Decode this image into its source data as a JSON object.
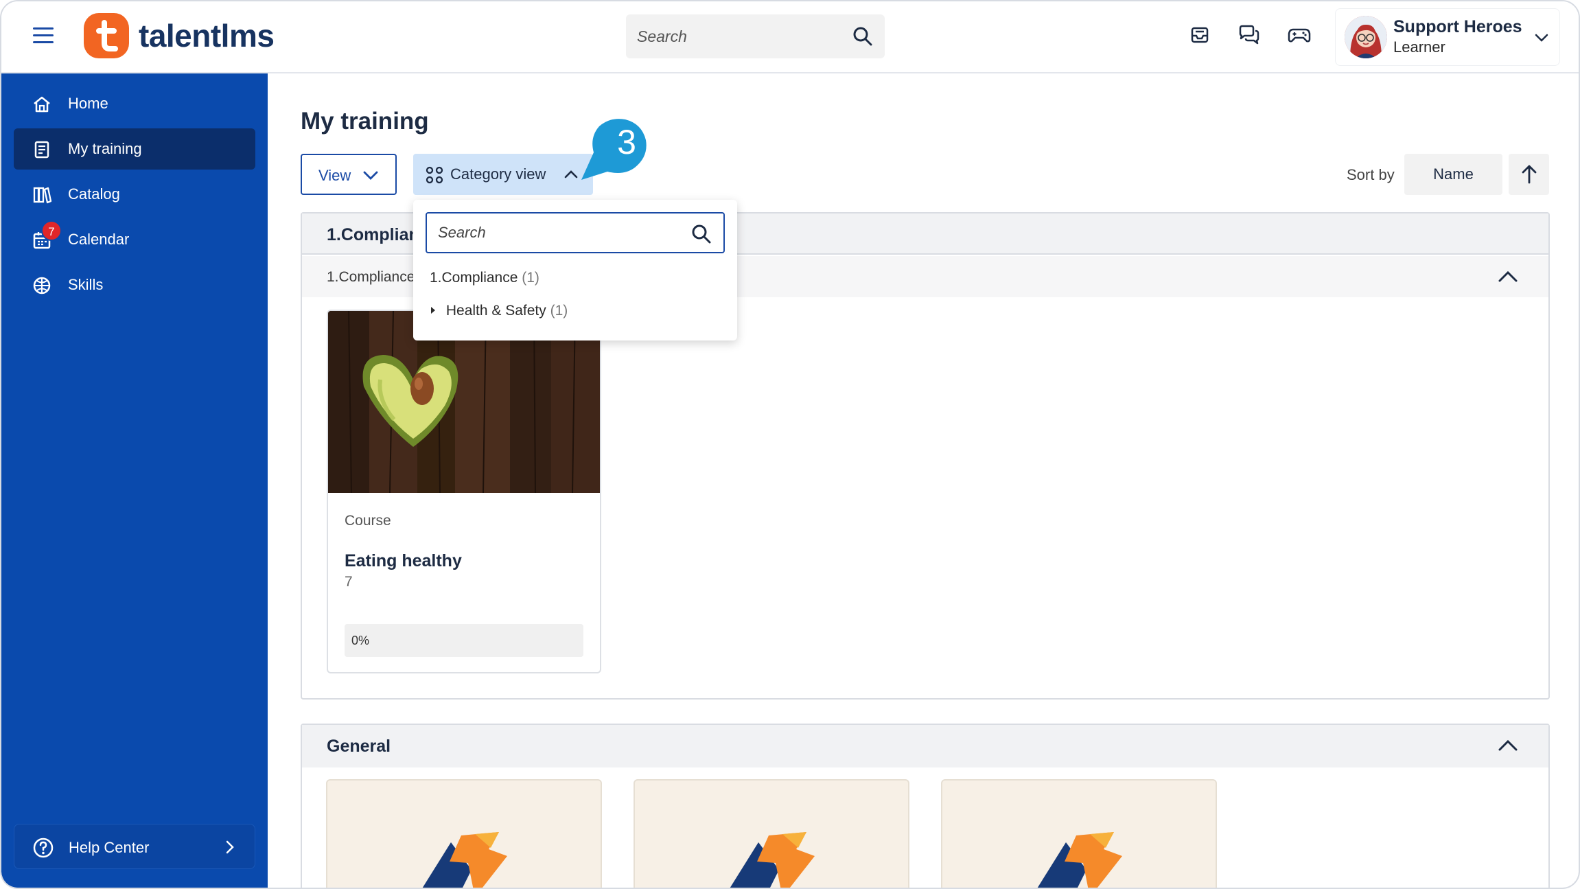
{
  "brand": {
    "name": "talentlms",
    "accent": "#f26522",
    "sidebar_color": "#0a4aad"
  },
  "header": {
    "search_placeholder": "Search",
    "user": {
      "name": "Support Heroes",
      "role": "Learner"
    }
  },
  "sidebar": {
    "items": [
      {
        "label": "Home",
        "icon": "home-icon"
      },
      {
        "label": "My training",
        "icon": "training-icon"
      },
      {
        "label": "Catalog",
        "icon": "catalog-icon"
      },
      {
        "label": "Calendar",
        "icon": "calendar-icon",
        "badge": "7"
      },
      {
        "label": "Skills",
        "icon": "skills-icon"
      }
    ],
    "help": "Help Center"
  },
  "main": {
    "title": "My training",
    "view_button": "View",
    "category_view_button": "Category view",
    "callout_number": "3",
    "sort_by_label": "Sort by",
    "sort_field": "Name"
  },
  "dropdown": {
    "search_placeholder": "Search",
    "items": [
      {
        "label": "1.Compliance",
        "count": "(1)"
      },
      {
        "label": "Health & Safety",
        "count": "(1)"
      }
    ]
  },
  "groups": [
    {
      "title": "1.Complian",
      "subgroup": "1.Compliance",
      "courses": [
        {
          "type": "Course",
          "title": "Eating healthy",
          "code": "7",
          "progress_label": "0%",
          "progress": 0
        }
      ]
    },
    {
      "title": "General"
    }
  ]
}
